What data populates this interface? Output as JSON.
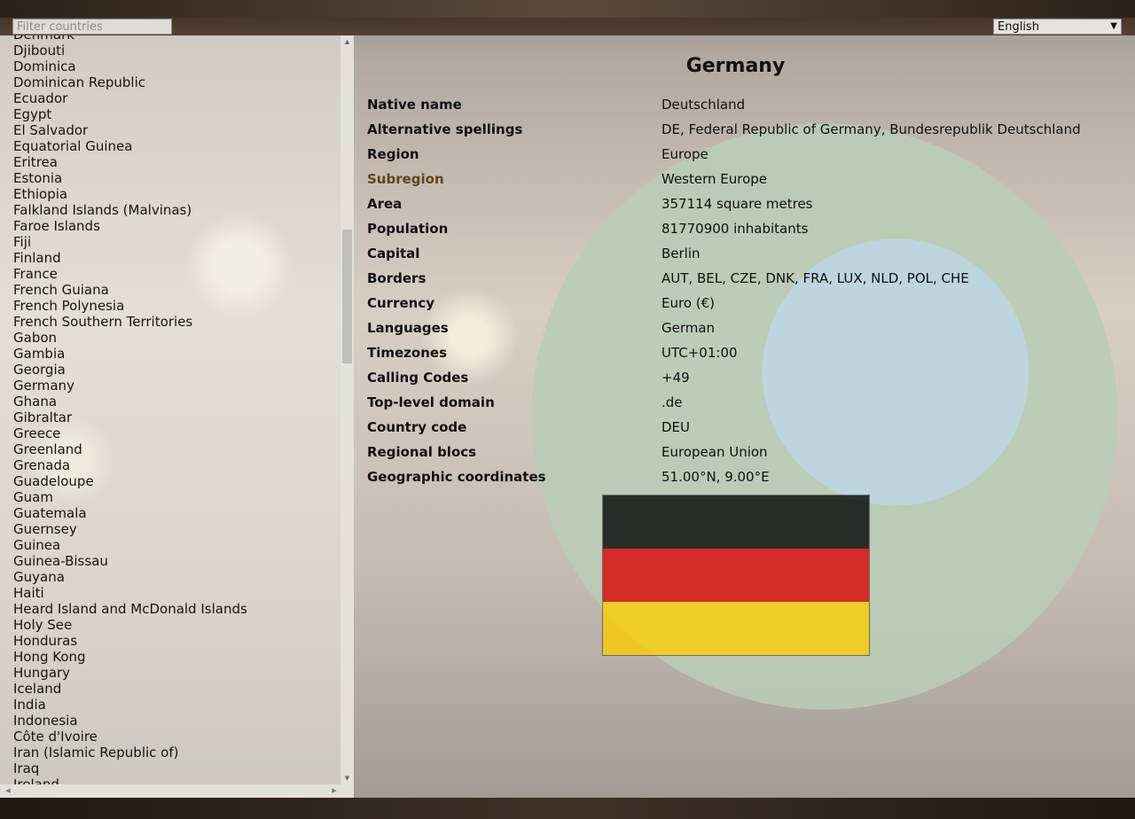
{
  "filter": {
    "placeholder": "Filter countries",
    "value": ""
  },
  "language_select": {
    "selected": "English"
  },
  "sidebar": {
    "countries": [
      "Denmark",
      "Djibouti",
      "Dominica",
      "Dominican Republic",
      "Ecuador",
      "Egypt",
      "El Salvador",
      "Equatorial Guinea",
      "Eritrea",
      "Estonia",
      "Ethiopia",
      "Falkland Islands (Malvinas)",
      "Faroe Islands",
      "Fiji",
      "Finland",
      "France",
      "French Guiana",
      "French Polynesia",
      "French Southern Territories",
      "Gabon",
      "Gambia",
      "Georgia",
      "Germany",
      "Ghana",
      "Gibraltar",
      "Greece",
      "Greenland",
      "Grenada",
      "Guadeloupe",
      "Guam",
      "Guatemala",
      "Guernsey",
      "Guinea",
      "Guinea-Bissau",
      "Guyana",
      "Haiti",
      "Heard Island and McDonald Islands",
      "Holy See",
      "Honduras",
      "Hong Kong",
      "Hungary",
      "Iceland",
      "India",
      "Indonesia",
      "Côte d'Ivoire",
      "Iran (Islamic Republic of)",
      "Iraq",
      "Ireland"
    ]
  },
  "country": {
    "name": "Germany",
    "details": [
      {
        "label": "Native name",
        "value": "Deutschland"
      },
      {
        "label": "Alternative spellings",
        "value": "DE, Federal Republic of Germany, Bundesrepublik Deutschland"
      },
      {
        "label": "Region",
        "value": "Europe"
      },
      {
        "label": "Subregion",
        "value": "Western Europe"
      },
      {
        "label": "Area",
        "value": "357114 square metres"
      },
      {
        "label": "Population",
        "value": "81770900 inhabitants"
      },
      {
        "label": "Capital",
        "value": "Berlin"
      },
      {
        "label": "Borders",
        "value": "AUT, BEL, CZE, DNK, FRA, LUX, NLD, POL, CHE"
      },
      {
        "label": "Currency",
        "value": "Euro (€)"
      },
      {
        "label": "Languages",
        "value": "German"
      },
      {
        "label": "Timezones",
        "value": "UTC+01:00"
      },
      {
        "label": "Calling Codes",
        "value": "+49"
      },
      {
        "label": "Top-level domain",
        "value": ".de"
      },
      {
        "label": "Country code",
        "value": "DEU"
      },
      {
        "label": "Regional blocs",
        "value": "European Union"
      },
      {
        "label": "Geographic coordinates",
        "value": "51.00°N, 9.00°E"
      }
    ],
    "flag_colors": [
      "#000000",
      "#dd0000",
      "#ffce00"
    ]
  },
  "colors": {
    "highlight_label": "#5e4419"
  }
}
